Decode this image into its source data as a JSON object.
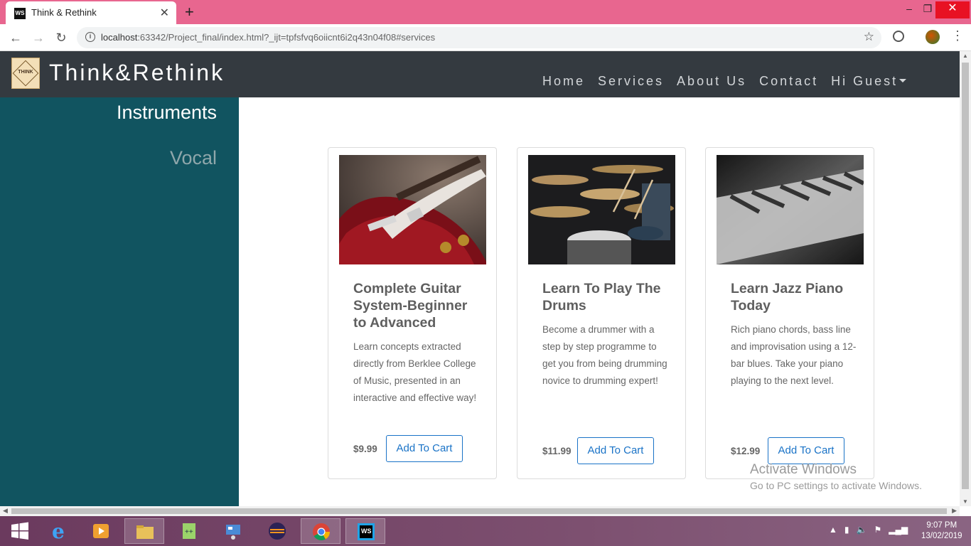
{
  "browser": {
    "tab_title": "Think & Rethink",
    "tab_favicon": "WS",
    "url_host": "localhost",
    "url_rest": ":63342/Project_final/index.html?_ijt=tpfsfvq6oiicnt6i2q43n04f08#services"
  },
  "site": {
    "brand": "Think&Rethink",
    "logo_text": "THINK",
    "nav": [
      "Home",
      "Services",
      "About Us",
      "Contact",
      "Hi Guest"
    ]
  },
  "sidebar": {
    "items": [
      "Instruments",
      "Vocal"
    ]
  },
  "cards": [
    {
      "title": "Complete Guitar System-Beginner to Advanced",
      "text": "Learn concepts extracted directly from Berklee College of Music, presented in an interactive and effective way!",
      "price": "$9.99",
      "button": "Add To Cart",
      "image": "guitar-image"
    },
    {
      "title": "Learn To Play The Drums",
      "text": "Become a drummer with a step by step programme to get you from being drumming novice to drumming expert!",
      "price": "$11.99",
      "button": "Add To Cart",
      "image": "drums-image"
    },
    {
      "title": "Learn Jazz Piano Today",
      "text": "Rich piano chords, bass line and improvisation using a 12-bar blues. Take your piano playing to the next level.",
      "price": "$12.99",
      "button": "Add To Cart",
      "image": "piano-image"
    }
  ],
  "watermark": {
    "heading": "Activate Windows",
    "sub": "Go to PC settings to activate Windows."
  },
  "taskbar": {
    "time": "9:07 PM",
    "date": "13/02/2019"
  },
  "colors": {
    "titlebar": "#e8668f",
    "navbar": "#343a40",
    "sidebar": "#115460",
    "button_accent": "#1a73c7"
  }
}
